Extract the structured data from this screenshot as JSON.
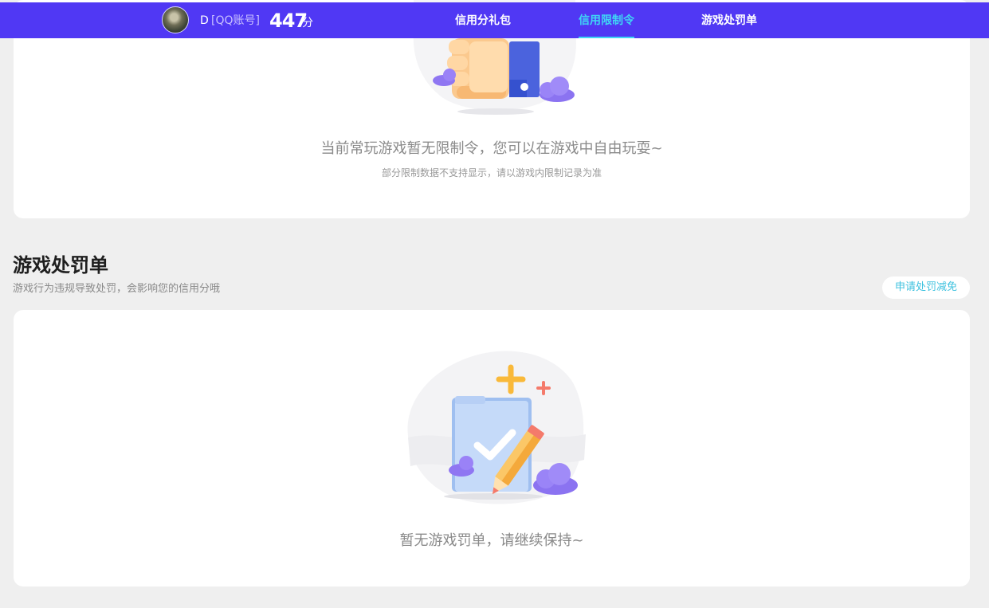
{
  "header": {
    "nickname": "D",
    "account_type": "[QQ账号]",
    "score": "447",
    "score_unit": "分",
    "tabs": [
      {
        "label": "信用分礼包",
        "active": false
      },
      {
        "label": "信用限制令",
        "active": true
      },
      {
        "label": "游戏处罚单",
        "active": false
      }
    ],
    "active_color": "#3fd6f5",
    "bar_color": "#5038f4"
  },
  "limit_section": {
    "empty_message": "当前常玩游戏暂无限制令，您可以在游戏中自由玩耍~",
    "note": "部分限制数据不支持显示，请以游戏内限制记录为准",
    "illustration_icon": "hand-card-icon"
  },
  "penalty_section": {
    "title": "游戏处罚单",
    "description": "游戏行为违规导致处罚，会影响您的信用分哦",
    "appeal_button": "申请处罚减免",
    "empty_message": "暂无游戏罚单，请继续保持~",
    "illustration_icon": "checked-document-pencil-icon"
  }
}
